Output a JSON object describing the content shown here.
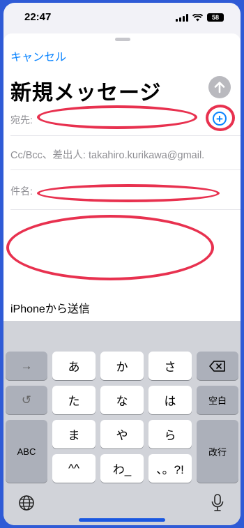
{
  "status_bar": {
    "time": "22:47",
    "battery": "58"
  },
  "header": {
    "cancel_label": "キャンセル",
    "title": "新規メッセージ"
  },
  "fields": {
    "to_label": "宛先:",
    "cc_label": "Cc/Bcc、差出人: takahiro.kurikawa@gmail.",
    "subject_label": "件名:"
  },
  "body": {
    "signature": "iPhoneから送信"
  },
  "keyboard": {
    "rows": [
      [
        "→",
        "あ",
        "か",
        "さ",
        "⌫"
      ],
      [
        "↺",
        "た",
        "な",
        "は",
        "空白"
      ],
      [
        "ABC",
        "ま",
        "や",
        "ら",
        "改行"
      ],
      [
        "^^",
        "わ_",
        "、。?!"
      ]
    ],
    "icons": {
      "arrow": "right-arrow-icon",
      "delete": "delete-icon",
      "undo": "undo-icon",
      "globe": "globe-icon",
      "mic": "microphone-icon"
    }
  },
  "colors": {
    "accent": "#0a84ff",
    "annotation": "#e8314f",
    "border": "#2f5bd6"
  }
}
